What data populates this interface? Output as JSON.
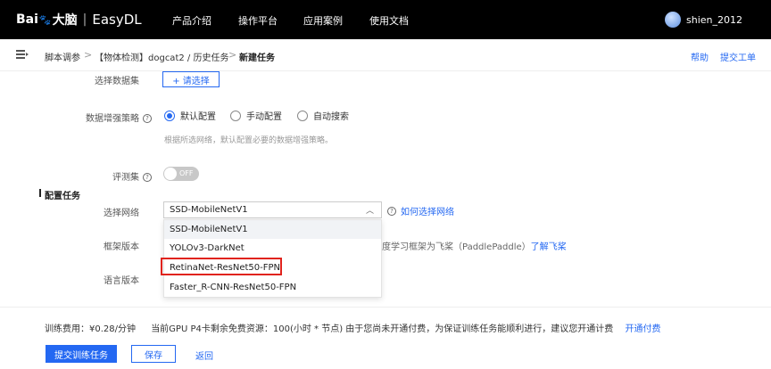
{
  "header": {
    "logo_text": "Bai",
    "logo_suffix": "大脑",
    "logo_sep": "|",
    "product": "EasyDL",
    "nav": [
      "产品介绍",
      "操作平台",
      "应用案例",
      "使用文档"
    ],
    "username": "shien_2012"
  },
  "breadcrumb": {
    "items": [
      "脚本调参",
      "【物体检测】dogcat2 / 历史任务",
      "新建任务"
    ],
    "separator": ">",
    "help": "帮助",
    "ticket": "提交工单"
  },
  "form": {
    "dataset_label": "选择数据集",
    "dataset_button": "+ 请选择",
    "augment_label": "数据增强策略",
    "augment_options": [
      "默认配置",
      "手动配置",
      "自动搜索"
    ],
    "augment_selected": "默认配置",
    "augment_hint": "根据所选网络，默认配置必要的数据增强策略。",
    "eval_label": "评测集",
    "eval_toggle_text": "OFF",
    "section_title": "配置任务",
    "network_label": "选择网络",
    "network_value": "SSD-MobileNetV1",
    "network_help": "如何选择网络",
    "network_options": [
      "SSD-MobileNetV1",
      "YOLOv3-DarkNet",
      "RetinaNet-ResNet50-FPN",
      "Faster_R-CNN-ResNet50-FPN"
    ],
    "framework_label": "框架版本",
    "framework_note": "度学习框架为飞桨（PaddlePaddle）",
    "framework_link": "了解飞桨",
    "language_label": "语言版本",
    "question_icon": "?"
  },
  "footer": {
    "fee_label": "训练费用：",
    "fee_value": "¥0.28/分钟",
    "gpu_text": "当前GPU P4卡剩余免费资源：100(小时 * 节点)  由于您尚未开通付费，为保证训练任务能顺利进行，建议您开通计费",
    "open_billing": "开通付费",
    "submit": "提交训练任务",
    "save": "保存",
    "back": "返回"
  },
  "colors": {
    "accent": "#2468f2",
    "highlight": "#e0231d",
    "topbar": "#000000"
  }
}
